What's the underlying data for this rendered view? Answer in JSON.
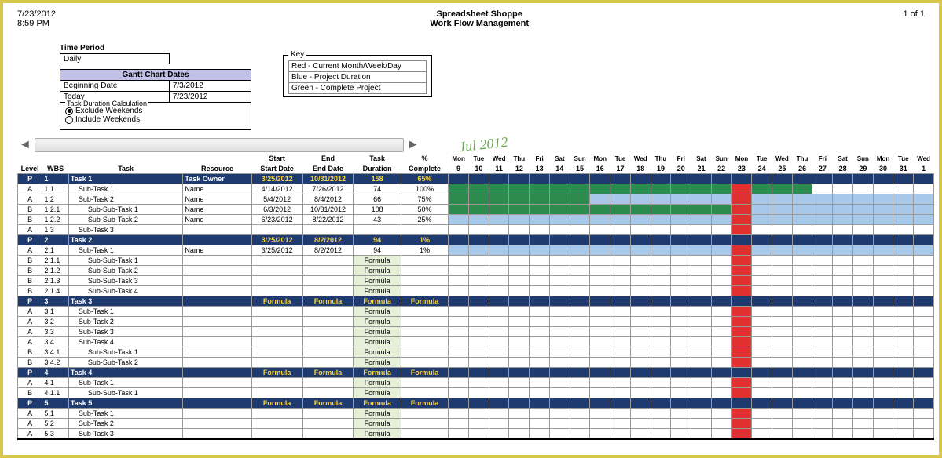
{
  "header": {
    "date": "7/23/2012",
    "time": "8:59 PM",
    "title1": "Spreadsheet Shoppe",
    "title2": "Work Flow Management",
    "page": "1 of 1"
  },
  "timePeriod": {
    "label": "Time Period",
    "value": "Daily"
  },
  "ganttDates": {
    "title": "Gantt Chart Dates",
    "rows": [
      {
        "label": "Beginning Date",
        "value": "7/3/2012"
      },
      {
        "label": "Today",
        "value": "7/23/2012"
      }
    ]
  },
  "taskDur": {
    "legend": "Task Duration Calculation",
    "opt1": "Exclude Weekends",
    "opt2": "Include Weekends"
  },
  "key": {
    "legend": "Key",
    "items": [
      "Red - Current Month/Week/Day",
      "Blue - Project Duration",
      "Green - Complete Project"
    ]
  },
  "timelineLabel": "Jul 2012",
  "columns": {
    "level": "Level",
    "wbs": "WBS",
    "task": "Task",
    "resource": "Resource",
    "start1": "Start",
    "start2": "Start Date",
    "end1": "End",
    "end2": "End Date",
    "dur1": "Task",
    "dur2": "Duration",
    "pct1": "%",
    "pct2": "Complete"
  },
  "days": [
    {
      "dow": "Mon",
      "d": "9"
    },
    {
      "dow": "Tue",
      "d": "10"
    },
    {
      "dow": "Wed",
      "d": "11"
    },
    {
      "dow": "Thu",
      "d": "12"
    },
    {
      "dow": "Fri",
      "d": "13"
    },
    {
      "dow": "Sat",
      "d": "14"
    },
    {
      "dow": "Sun",
      "d": "15"
    },
    {
      "dow": "Mon",
      "d": "16"
    },
    {
      "dow": "Tue",
      "d": "17"
    },
    {
      "dow": "Wed",
      "d": "18"
    },
    {
      "dow": "Thu",
      "d": "19"
    },
    {
      "dow": "Fri",
      "d": "20"
    },
    {
      "dow": "Sat",
      "d": "21"
    },
    {
      "dow": "Sun",
      "d": "22"
    },
    {
      "dow": "Mon",
      "d": "23"
    },
    {
      "dow": "Tue",
      "d": "24"
    },
    {
      "dow": "Wed",
      "d": "25"
    },
    {
      "dow": "Thu",
      "d": "26"
    },
    {
      "dow": "Fri",
      "d": "27"
    },
    {
      "dow": "Sat",
      "d": "28"
    },
    {
      "dow": "Sun",
      "d": "29"
    },
    {
      "dow": "Mon",
      "d": "30"
    },
    {
      "dow": "Tue",
      "d": "31"
    },
    {
      "dow": "Wed",
      "d": "1"
    }
  ],
  "rows": [
    {
      "type": "proj",
      "level": "P",
      "wbs": "1",
      "task": "Task 1",
      "res": "Task Owner",
      "start": "3/25/2012",
      "end": "10/31/2012",
      "dur": "158",
      "pct": "65%",
      "bars": {
        "green": [
          0,
          13
        ],
        "blue": [
          13,
          24
        ],
        "today": 14
      }
    },
    {
      "type": "sub",
      "level": "A",
      "wbs": "1.1",
      "task": "Sub-Task 1",
      "indent": 1,
      "res": "Name",
      "start": "4/14/2012",
      "end": "7/26/2012",
      "dur": "74",
      "pct": "100%",
      "bars": {
        "green": [
          0,
          18
        ],
        "today": 14
      }
    },
    {
      "type": "sub",
      "level": "A",
      "wbs": "1.2",
      "task": "Sub-Task 2",
      "indent": 1,
      "res": "Name",
      "start": "5/4/2012",
      "end": "8/4/2012",
      "dur": "66",
      "pct": "75%",
      "bars": {
        "green": [
          0,
          7
        ],
        "blue": [
          7,
          24
        ],
        "today": 14
      }
    },
    {
      "type": "sub",
      "level": "B",
      "wbs": "1.2.1",
      "task": "Sub-Sub-Task 1",
      "indent": 2,
      "res": "Name",
      "start": "6/3/2012",
      "end": "10/31/2012",
      "dur": "108",
      "pct": "50%",
      "bars": {
        "green": [
          0,
          14
        ],
        "blue": [
          14,
          24
        ],
        "today": 14
      }
    },
    {
      "type": "sub",
      "level": "B",
      "wbs": "1.2.2",
      "task": "Sub-Sub-Task 2",
      "indent": 2,
      "res": "Name",
      "start": "6/23/2012",
      "end": "8/22/2012",
      "dur": "43",
      "pct": "25%",
      "bars": {
        "blue": [
          0,
          24
        ],
        "today": 14
      }
    },
    {
      "type": "sub",
      "level": "A",
      "wbs": "1.3",
      "task": "Sub-Task 3",
      "indent": 1,
      "res": "",
      "start": "",
      "end": "",
      "dur": "",
      "pct": "",
      "bars": {
        "today": 14
      }
    },
    {
      "type": "proj",
      "level": "P",
      "wbs": "2",
      "task": "Task 2",
      "res": "",
      "start": "3/25/2012",
      "end": "8/2/2012",
      "dur": "94",
      "pct": "1%",
      "bars": {
        "blue": [
          0,
          24
        ],
        "today": 14
      }
    },
    {
      "type": "sub",
      "level": "A",
      "wbs": "2.1",
      "task": "Sub-Task 1",
      "indent": 1,
      "res": "Name",
      "start": "3/25/2012",
      "end": "8/2/2012",
      "dur": "94",
      "pct": "1%",
      "bars": {
        "blue": [
          0,
          24
        ],
        "today": 14
      }
    },
    {
      "type": "sub",
      "level": "B",
      "wbs": "2.1.1",
      "task": "Sub-Sub-Task 1",
      "indent": 2,
      "res": "",
      "start": "",
      "end": "",
      "dur": "Formula",
      "pct": "",
      "formula": [
        "dur"
      ],
      "bars": {
        "today": 14
      }
    },
    {
      "type": "sub",
      "level": "B",
      "wbs": "2.1.2",
      "task": "Sub-Sub-Task 2",
      "indent": 2,
      "res": "",
      "start": "",
      "end": "",
      "dur": "Formula",
      "pct": "",
      "formula": [
        "dur"
      ],
      "bars": {
        "today": 14
      }
    },
    {
      "type": "sub",
      "level": "B",
      "wbs": "2.1.3",
      "task": "Sub-Sub-Task 3",
      "indent": 2,
      "res": "",
      "start": "",
      "end": "",
      "dur": "Formula",
      "pct": "",
      "formula": [
        "dur"
      ],
      "bars": {
        "today": 14
      }
    },
    {
      "type": "sub",
      "level": "B",
      "wbs": "2.1.4",
      "task": "Sub-Sub-Task 4",
      "indent": 2,
      "res": "",
      "start": "",
      "end": "",
      "dur": "Formula",
      "pct": "",
      "formula": [
        "dur"
      ],
      "bars": {
        "today": 14
      }
    },
    {
      "type": "proj",
      "level": "P",
      "wbs": "3",
      "task": "Task 3",
      "res": "",
      "start": "Formula",
      "end": "Formula",
      "dur": "Formula",
      "pct": "Formula",
      "bars": {
        "today": 14
      }
    },
    {
      "type": "sub",
      "level": "A",
      "wbs": "3.1",
      "task": "Sub-Task 1",
      "indent": 1,
      "res": "",
      "start": "",
      "end": "",
      "dur": "Formula",
      "pct": "",
      "formula": [
        "dur"
      ],
      "bars": {
        "today": 14
      }
    },
    {
      "type": "sub",
      "level": "A",
      "wbs": "3.2",
      "task": "Sub-Task 2",
      "indent": 1,
      "res": "",
      "start": "",
      "end": "",
      "dur": "Formula",
      "pct": "",
      "formula": [
        "dur"
      ],
      "bars": {
        "today": 14
      }
    },
    {
      "type": "sub",
      "level": "A",
      "wbs": "3.3",
      "task": "Sub-Task 3",
      "indent": 1,
      "res": "",
      "start": "",
      "end": "",
      "dur": "Formula",
      "pct": "",
      "formula": [
        "dur"
      ],
      "bars": {
        "today": 14
      }
    },
    {
      "type": "sub",
      "level": "A",
      "wbs": "3.4",
      "task": "Sub-Task 4",
      "indent": 1,
      "res": "",
      "start": "",
      "end": "",
      "dur": "Formula",
      "pct": "",
      "formula": [
        "dur"
      ],
      "bars": {
        "today": 14
      }
    },
    {
      "type": "sub",
      "level": "B",
      "wbs": "3.4.1",
      "task": "Sub-Sub-Task 1",
      "indent": 2,
      "res": "",
      "start": "",
      "end": "",
      "dur": "Formula",
      "pct": "",
      "formula": [
        "dur"
      ],
      "bars": {
        "today": 14
      }
    },
    {
      "type": "sub",
      "level": "B",
      "wbs": "3.4.2",
      "task": "Sub-Sub-Task 2",
      "indent": 2,
      "res": "",
      "start": "",
      "end": "",
      "dur": "Formula",
      "pct": "",
      "formula": [
        "dur"
      ],
      "bars": {
        "today": 14
      }
    },
    {
      "type": "proj",
      "level": "P",
      "wbs": "4",
      "task": "Task 4",
      "res": "",
      "start": "Formula",
      "end": "Formula",
      "dur": "Formula",
      "pct": "Formula",
      "bars": {
        "today": 14
      }
    },
    {
      "type": "sub",
      "level": "A",
      "wbs": "4.1",
      "task": "Sub-Task 1",
      "indent": 1,
      "res": "",
      "start": "",
      "end": "",
      "dur": "Formula",
      "pct": "",
      "formula": [
        "dur"
      ],
      "bars": {
        "today": 14
      }
    },
    {
      "type": "sub",
      "level": "B",
      "wbs": "4.1.1",
      "task": "Sub-Sub-Task 1",
      "indent": 2,
      "res": "",
      "start": "",
      "end": "",
      "dur": "Formula",
      "pct": "",
      "formula": [
        "dur"
      ],
      "bars": {
        "today": 14
      }
    },
    {
      "type": "proj",
      "level": "P",
      "wbs": "5",
      "task": "Task 5",
      "res": "",
      "start": "Formula",
      "end": "Formula",
      "dur": "Formula",
      "pct": "Formula",
      "bars": {
        "today": 14
      }
    },
    {
      "type": "sub",
      "level": "A",
      "wbs": "5.1",
      "task": "Sub-Task 1",
      "indent": 1,
      "res": "",
      "start": "",
      "end": "",
      "dur": "Formula",
      "pct": "",
      "formula": [
        "dur"
      ],
      "bars": {
        "today": 14
      }
    },
    {
      "type": "sub",
      "level": "A",
      "wbs": "5.2",
      "task": "Sub-Task 2",
      "indent": 1,
      "res": "",
      "start": "",
      "end": "",
      "dur": "Formula",
      "pct": "",
      "formula": [
        "dur"
      ],
      "bars": {
        "today": 14
      }
    },
    {
      "type": "sub",
      "level": "A",
      "wbs": "5.3",
      "task": "Sub-Task 3",
      "indent": 1,
      "res": "",
      "start": "",
      "end": "",
      "dur": "Formula",
      "pct": "",
      "formula": [
        "dur"
      ],
      "bars": {
        "today": 14
      }
    }
  ],
  "chart_data": {
    "type": "table",
    "title": "Work Flow Management Gantt",
    "date_range": [
      "7/9/2012",
      "8/1/2012"
    ],
    "today_index": 14,
    "series": [
      {
        "name": "Task 1",
        "green": [
          0,
          13
        ],
        "blue": [
          13,
          24
        ]
      },
      {
        "name": "Sub-Task 1 (1.1)",
        "green": [
          0,
          18
        ]
      },
      {
        "name": "Sub-Task 2 (1.2)",
        "green": [
          0,
          7
        ],
        "blue": [
          7,
          24
        ]
      },
      {
        "name": "Sub-Sub-Task 1 (1.2.1)",
        "green": [
          0,
          14
        ],
        "blue": [
          14,
          24
        ]
      },
      {
        "name": "Sub-Sub-Task 2 (1.2.2)",
        "blue": [
          0,
          24
        ]
      },
      {
        "name": "Task 2",
        "blue": [
          0,
          24
        ]
      },
      {
        "name": "Sub-Task 1 (2.1)",
        "blue": [
          0,
          24
        ]
      }
    ]
  }
}
